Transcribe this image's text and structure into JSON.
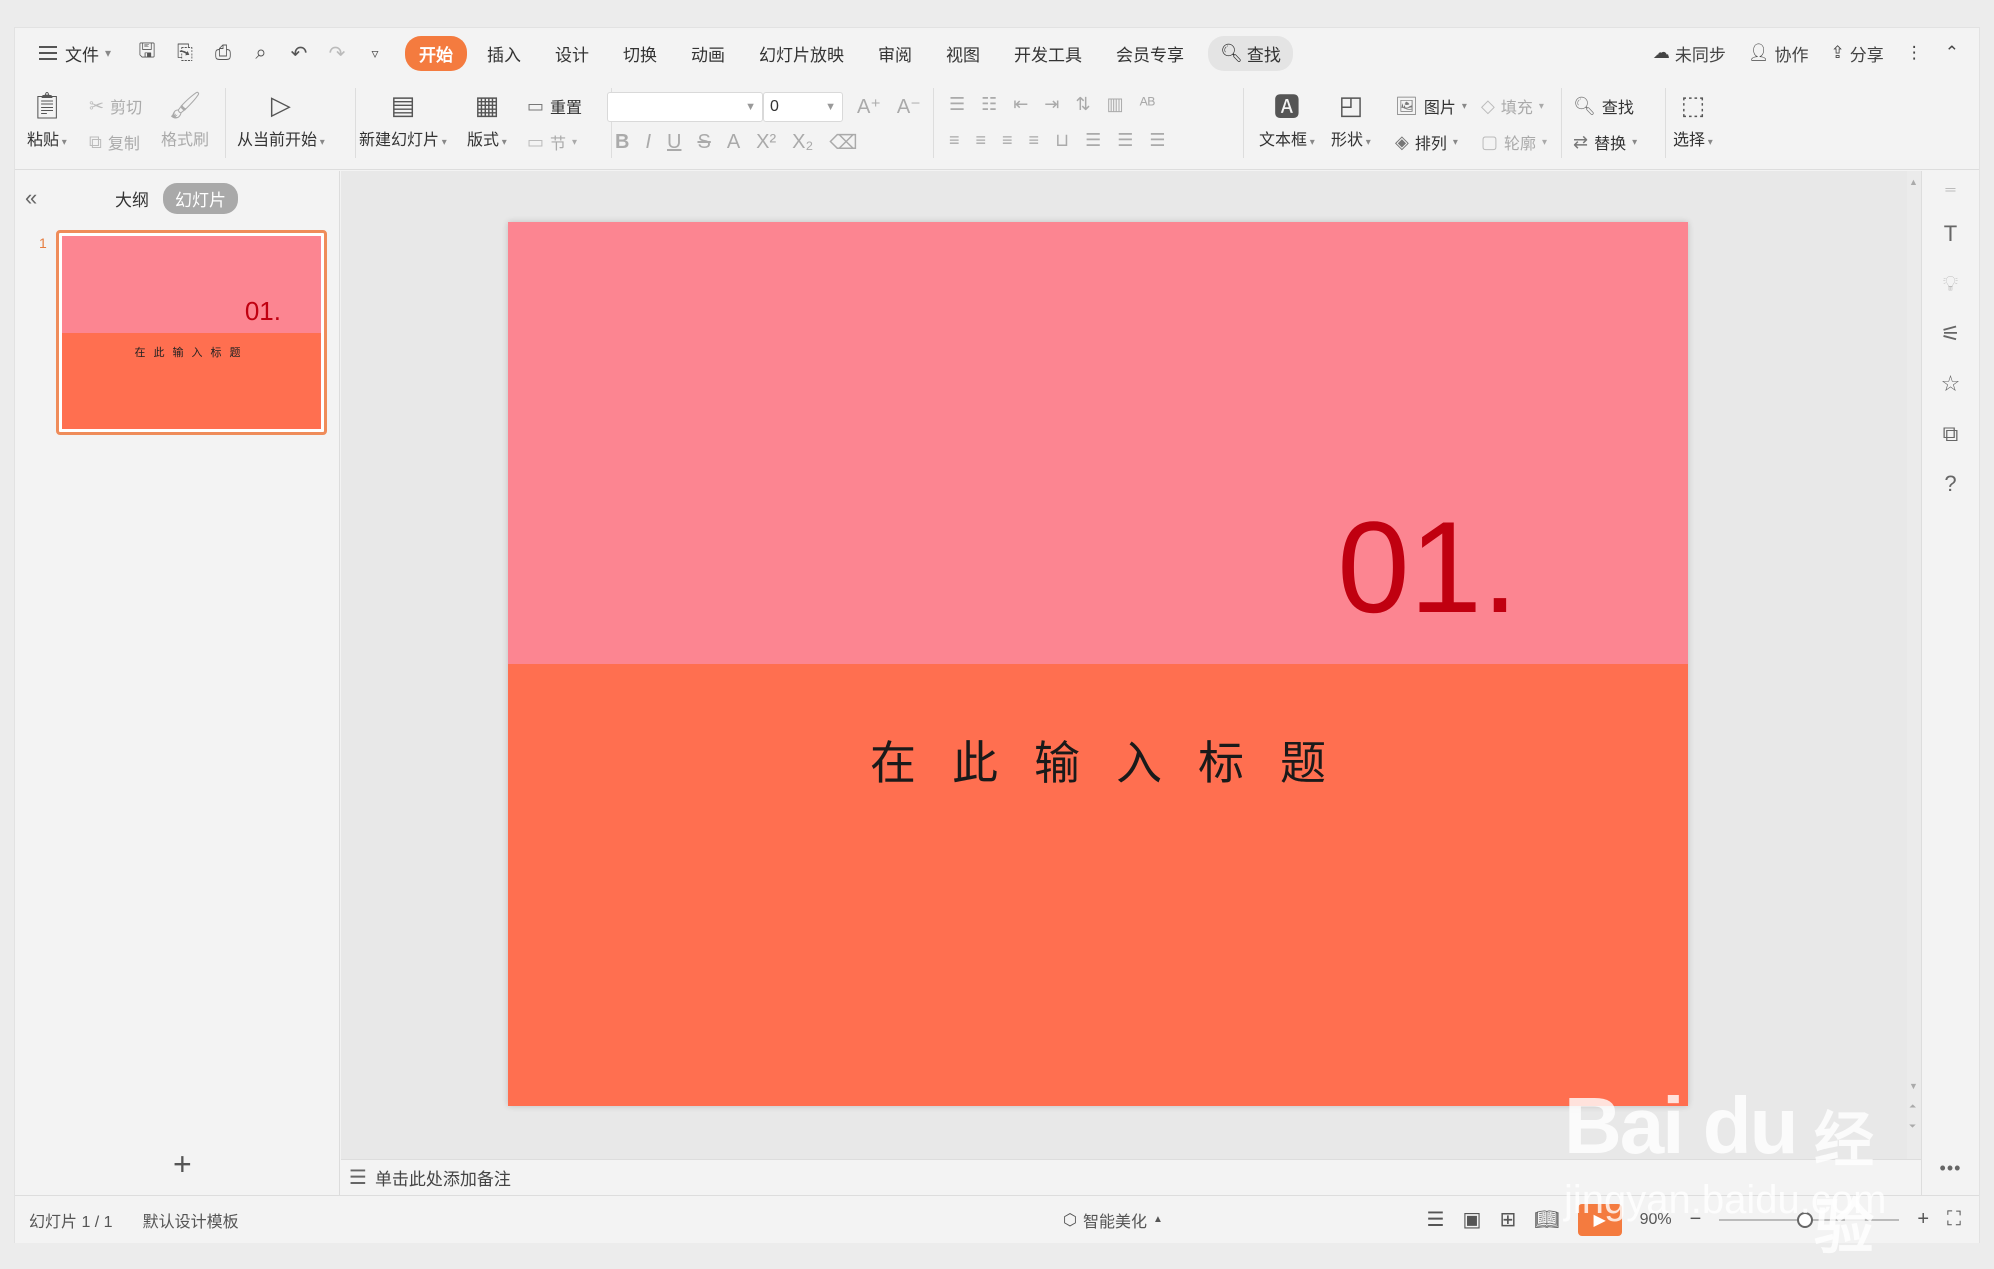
{
  "menu": {
    "file": "文件",
    "tabs": [
      "开始",
      "插入",
      "设计",
      "切换",
      "动画",
      "幻灯片放映",
      "审阅",
      "视图",
      "开发工具",
      "会员专享"
    ],
    "search": "查找",
    "right": {
      "sync": "未同步",
      "collab": "协作",
      "share": "分享"
    }
  },
  "ribbon": {
    "paste": "粘贴",
    "cut": "剪切",
    "copy": "复制",
    "format_painter": "格式刷",
    "from_current": "从当前开始",
    "new_slide": "新建幻灯片",
    "layout": "版式",
    "reset": "重置",
    "section": "节",
    "font_name": "",
    "font_size": "0",
    "textbox": "文本框",
    "shape": "形状",
    "picture": "图片",
    "fill": "填充",
    "arrange": "排列",
    "outline": "轮廓",
    "find": "查找",
    "replace": "替换",
    "select": "选择"
  },
  "panel": {
    "outline_tab": "大纲",
    "slides_tab": "幻灯片",
    "thumb_index": "1"
  },
  "slide": {
    "number": "01.",
    "title": "在此输入标题"
  },
  "notes": {
    "placeholder": "单击此处添加备注"
  },
  "status": {
    "slide_count": "幻灯片 1 / 1",
    "template": "默认设计模板",
    "beautify": "智能美化",
    "zoom": "90%"
  },
  "watermark": {
    "logo": "Bai du",
    "jy": "经验",
    "url": "jingyan.baidu.com"
  },
  "colors": {
    "accent": "#f47b3f",
    "slide_top": "#fc8591",
    "slide_bottom": "#ff6f50",
    "number_red": "#c00010"
  }
}
